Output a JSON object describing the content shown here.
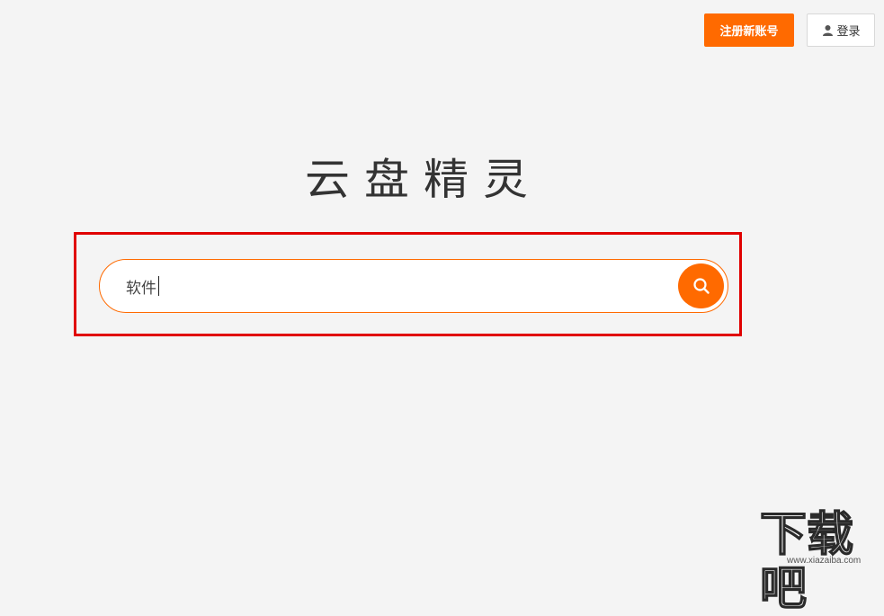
{
  "header": {
    "register_label": "注册新账号",
    "login_label": "登录",
    "user_icon": "user-icon"
  },
  "brand": {
    "logo_chars": [
      "云",
      "盘",
      "精",
      "灵"
    ]
  },
  "search": {
    "value": "软件",
    "button_icon": "search-icon"
  },
  "watermark": {
    "text": "下载吧",
    "url": "www.xiazaiba.com"
  },
  "colors": {
    "accent": "#ff6a00",
    "highlight": "#e00000",
    "background": "#f4f4f4"
  }
}
